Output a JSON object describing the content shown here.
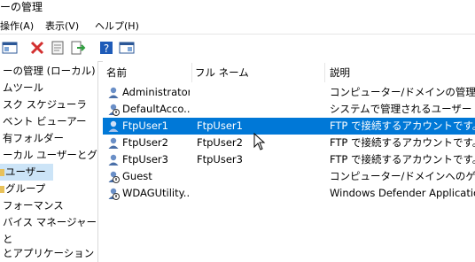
{
  "window": {
    "title_fragment": "ーの管理"
  },
  "menu": {
    "items": [
      "操作(A)",
      "表示(V)",
      "ヘルプ(H)"
    ]
  },
  "toolbar": {
    "buttons": [
      "console-tree-icon",
      "delete-icon",
      "properties-icon",
      "export-icon",
      "help-icon",
      "show-hide-icon"
    ]
  },
  "tree": {
    "items": [
      {
        "label": "ーの管理 (ローカル)"
      },
      {
        "label": "ムツール"
      },
      {
        "label": "スク スケジューラ"
      },
      {
        "label": "ベント ビューアー"
      },
      {
        "label": "有フォルダー"
      },
      {
        "label": "ーカル ユーザーとグループ"
      },
      {
        "label": "ユーザー"
      },
      {
        "label": "グループ"
      },
      {
        "label": "フォーマンス"
      },
      {
        "label": "バイス マネージャー"
      },
      {
        "label": "と"
      },
      {
        "label": "とアプリケーション"
      }
    ]
  },
  "table": {
    "columns": [
      "名前",
      "フル ネーム",
      "説明"
    ],
    "rows": [
      {
        "name": "Administrator",
        "fullname": "",
        "description": "コンピューター/ドメインの管理用 (ビ"
      },
      {
        "name": "DefaultAcco...",
        "fullname": "",
        "description": "システムで管理されるユーザー アカウ"
      },
      {
        "name": "FtpUser1",
        "fullname": "FtpUser1",
        "description": "FTP で接続するアカウントです。"
      },
      {
        "name": "FtpUser2",
        "fullname": "FtpUser2",
        "description": "FTP で接続するアカウントです。"
      },
      {
        "name": "FtpUser3",
        "fullname": "FtpUser3",
        "description": "FTP で接続するアカウントです。"
      },
      {
        "name": "Guest",
        "fullname": "",
        "description": "コンピューター/ドメインへのゲスト ア"
      },
      {
        "name": "WDAGUtility...",
        "fullname": "",
        "description": "Windows Defender Application"
      }
    ]
  },
  "colors": {
    "selection": "#0078d7",
    "tree_selection": "#cce4f7"
  }
}
